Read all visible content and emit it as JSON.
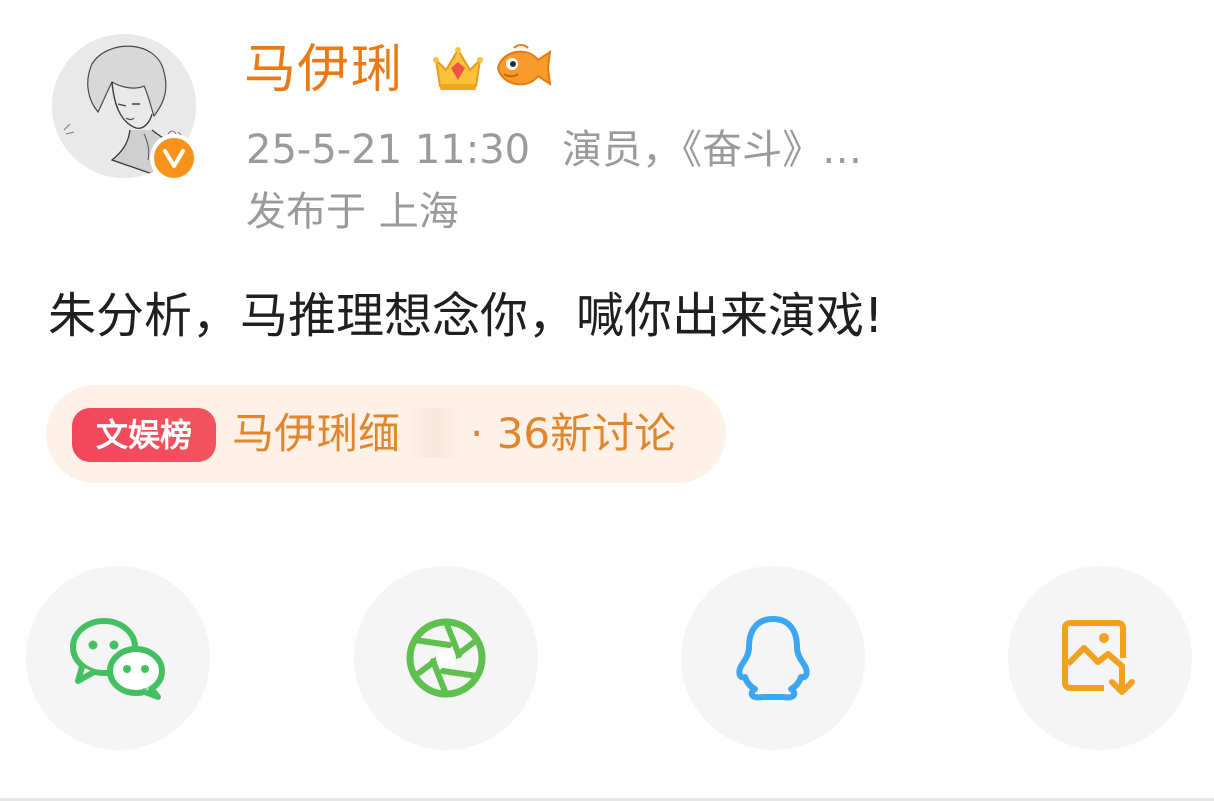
{
  "user": {
    "name": "马伊琍",
    "timestamp": "25-5-21 11:30",
    "description": "演员，《奋斗》…",
    "location": "发布于 上海"
  },
  "post": {
    "text": "朱分析，马推理想念你，喊你出来演戏!"
  },
  "topic": {
    "tag": "文娱榜",
    "name": "马伊琍缅",
    "count": "· 36新讨论"
  },
  "share_targets": [
    {
      "icon": "wechat-icon",
      "color": "#43c061"
    },
    {
      "icon": "moments-icon",
      "color": "#5fbf4f"
    },
    {
      "icon": "qq-icon",
      "color": "#3ca6f2"
    },
    {
      "icon": "save-image-icon",
      "color": "#f2a020"
    }
  ],
  "colors": {
    "username": "#e87a17",
    "meta": "#9a9a9a",
    "topic_text": "#e0862e",
    "topic_bg": "#fdf1e8",
    "rank_tag": "#f3465c"
  }
}
